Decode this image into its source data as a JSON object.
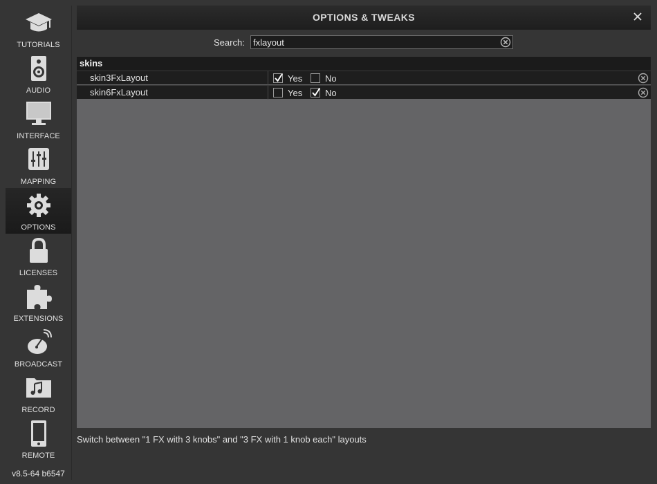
{
  "sidebar": {
    "items": [
      {
        "label": "TUTORIALS",
        "icon": "graduation-cap-icon"
      },
      {
        "label": "AUDIO",
        "icon": "speaker-icon"
      },
      {
        "label": "INTERFACE",
        "icon": "monitor-icon"
      },
      {
        "label": "MAPPING",
        "icon": "sliders-icon"
      },
      {
        "label": "OPTIONS",
        "icon": "gear-icon",
        "active": true
      },
      {
        "label": "LICENSES",
        "icon": "lock-icon"
      },
      {
        "label": "EXTENSIONS",
        "icon": "puzzle-icon"
      },
      {
        "label": "BROADCAST",
        "icon": "satellite-dish-icon"
      },
      {
        "label": "RECORD",
        "icon": "music-folder-icon"
      },
      {
        "label": "REMOTE",
        "icon": "phone-icon"
      }
    ],
    "version": "v8.5-64 b6547"
  },
  "window": {
    "title": "OPTIONS & TWEAKS",
    "close_icon": "close-icon"
  },
  "search": {
    "label": "Search:",
    "value": "fxlayout"
  },
  "options": {
    "group": "skins",
    "rows": [
      {
        "name": "skin3FxLayout",
        "yes_label": "Yes",
        "no_label": "No",
        "yes_checked": true,
        "no_checked": false
      },
      {
        "name": "skin6FxLayout",
        "yes_label": "Yes",
        "no_label": "No",
        "yes_checked": false,
        "no_checked": true
      }
    ]
  },
  "description": "Switch between \"1 FX with 3 knobs\" and \"3 FX with 1 knob each\" layouts",
  "colors": {
    "background": "#353535",
    "panel": "#646466",
    "row": "#1e1e1e",
    "active_sidebar": "#1e1e1e"
  }
}
